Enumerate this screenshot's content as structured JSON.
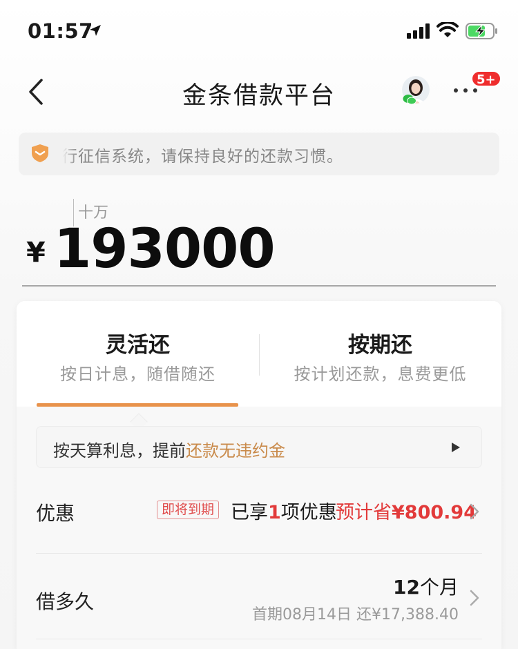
{
  "status_bar": {
    "time": "01:57",
    "icons": [
      "location-arrow-icon",
      "cellular-signal-icon",
      "wifi-icon",
      "battery-charging-icon"
    ]
  },
  "nav": {
    "title": "金条借款平台",
    "more_badge": "5+",
    "icons": [
      "back-icon",
      "avatar",
      "wechat-icon",
      "more-icon"
    ]
  },
  "notice": {
    "text": "行征信系统，请保持良好的还款习惯。",
    "icon": "shield-icon"
  },
  "amount": {
    "unit_hint": "十万",
    "currency": "¥",
    "value": "193000"
  },
  "tabs": [
    {
      "title": "灵活还",
      "subtitle": "按日计息，随借随还",
      "active": true
    },
    {
      "title": "按期还",
      "subtitle": "按计划还款，息费更低",
      "active": false
    }
  ],
  "hint": {
    "prefix": "按天算利息，提前",
    "accent": "还款无违约金",
    "icon": "play-icon"
  },
  "discount": {
    "label": "优惠",
    "tag": "即将到期",
    "enjoyed_prefix": "已享",
    "enjoyed_count": "1",
    "enjoyed_suffix": "项优惠",
    "save_prefix": "预计省",
    "save_amount": "¥800.94"
  },
  "term": {
    "label": "借多久",
    "months": "12",
    "months_unit": "个月",
    "first_payment": "首期08月14日 还¥17,388.40"
  },
  "colors": {
    "accent_orange": "#e8924b",
    "hint_accent": "#c98a4a",
    "red": "#e23a3a",
    "badge_red": "#ef2d2d"
  }
}
